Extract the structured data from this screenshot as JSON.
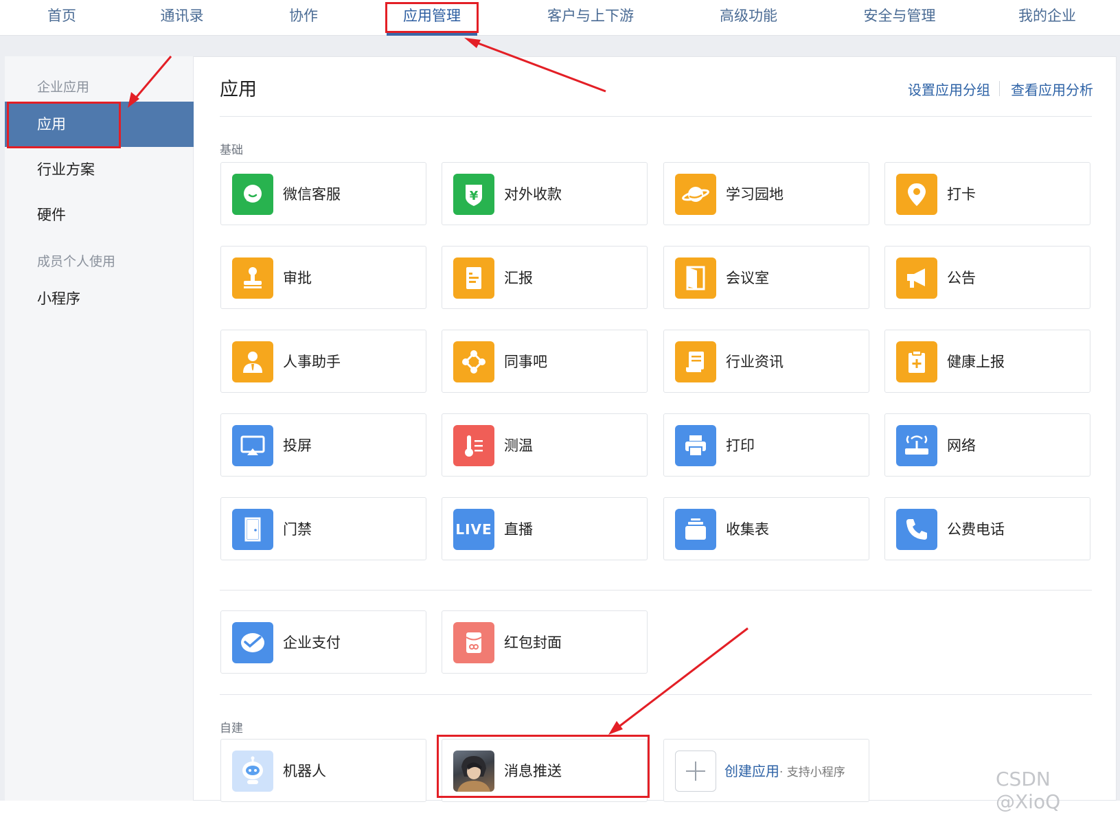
{
  "topnav": [
    "首页",
    "通讯录",
    "协作",
    "应用管理",
    "客户与上下游",
    "高级功能",
    "安全与管理",
    "我的企业"
  ],
  "sidebar": {
    "group1": "企业应用",
    "items1": [
      "应用",
      "行业方案",
      "硬件"
    ],
    "group2": "成员个人使用",
    "items2": [
      "小程序"
    ]
  },
  "content": {
    "title": "应用",
    "link_group": "设置应用分组",
    "link_analysis": "查看应用分析",
    "section_basic": "基础",
    "section_custom": "自建"
  },
  "apps_basic": [
    {
      "label": "微信客服",
      "icon": "chat-bubble-icon",
      "color": "#28b34f"
    },
    {
      "label": "对外收款",
      "icon": "yuan-shield-icon",
      "color": "#28b34f"
    },
    {
      "label": "学习园地",
      "icon": "planet-icon",
      "color": "#f6a71d"
    },
    {
      "label": "打卡",
      "icon": "location-pin-icon",
      "color": "#f6a71d"
    },
    {
      "label": "审批",
      "icon": "stamp-icon",
      "color": "#f6a71d"
    },
    {
      "label": "汇报",
      "icon": "report-doc-icon",
      "color": "#f6a71d"
    },
    {
      "label": "会议室",
      "icon": "door-open-icon",
      "color": "#f6a71d"
    },
    {
      "label": "公告",
      "icon": "megaphone-icon",
      "color": "#f6a71d"
    },
    {
      "label": "人事助手",
      "icon": "person-tie-icon",
      "color": "#f6a71d"
    },
    {
      "label": "同事吧",
      "icon": "network-nodes-icon",
      "color": "#f6a71d"
    },
    {
      "label": "行业资讯",
      "icon": "news-scroll-icon",
      "color": "#f6a71d"
    },
    {
      "label": "健康上报",
      "icon": "medical-clipboard-icon",
      "color": "#f6a71d"
    },
    {
      "label": "投屏",
      "icon": "airplay-icon",
      "color": "#4a8fe8"
    },
    {
      "label": "测温",
      "icon": "thermometer-icon",
      "color": "#f05e57"
    },
    {
      "label": "打印",
      "icon": "printer-icon",
      "color": "#4a8fe8"
    },
    {
      "label": "网络",
      "icon": "router-icon",
      "color": "#4a8fe8"
    },
    {
      "label": "门禁",
      "icon": "door-icon",
      "color": "#4a8fe8"
    },
    {
      "label": "直播",
      "icon": "live-icon",
      "color": "#4a8fe8",
      "icon_text": "LIVE"
    },
    {
      "label": "收集表",
      "icon": "stack-tray-icon",
      "color": "#4a8fe8"
    },
    {
      "label": "公费电话",
      "icon": "phone-icon",
      "color": "#4a8fe8"
    }
  ],
  "apps_extra": [
    {
      "label": "企业支付",
      "icon": "payment-check-icon",
      "color": "#4a8fe8"
    },
    {
      "label": "红包封面",
      "icon": "red-envelope-icon",
      "color": "#f17b72"
    }
  ],
  "apps_custom": [
    {
      "label": "机器人",
      "icon": "robot-icon"
    },
    {
      "label": "消息推送",
      "icon": "avatar-photo-icon"
    }
  ],
  "create_app": {
    "label": "创建应用",
    "sub": "· 支持小程序"
  },
  "watermark": "CSDN @XioQ"
}
